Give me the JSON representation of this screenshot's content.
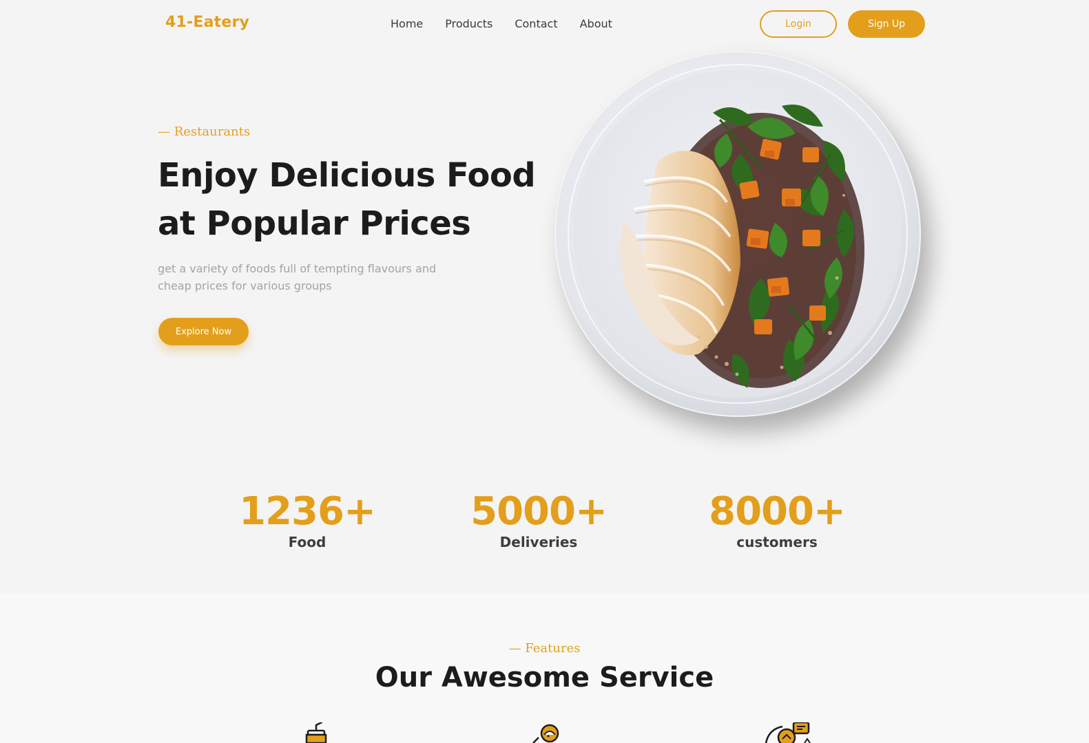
{
  "nav": {
    "logo": "41-Eatery",
    "menu": [
      "Home",
      "Products",
      "Contact",
      "About"
    ],
    "login_label": "Login",
    "signup_label": "Sign Up"
  },
  "hero": {
    "eyebrow": "— Restaurants",
    "title_line1": "Enjoy Delicious Food",
    "title_line2": "at Popular Prices",
    "description": "get a variety of foods full of tempting flavours and cheap prices for various groups",
    "cta_label": "Explore Now",
    "image": "plated-chicken-salad"
  },
  "stats": [
    {
      "value": "1236+",
      "label": "Food"
    },
    {
      "value": "5000+",
      "label": "Deliveries"
    },
    {
      "value": "8000+",
      "label": "customers"
    }
  ],
  "features": {
    "eyebrow": "— Features",
    "title": "Our Awesome Service",
    "icons": [
      "drink-cup-icon",
      "chef-icon",
      "delivery-chat-icon"
    ]
  },
  "colors": {
    "accent": "#e39f1b",
    "background": "#f4f4f4",
    "heading": "#1c1c1c",
    "muted": "#a3a3a3"
  }
}
